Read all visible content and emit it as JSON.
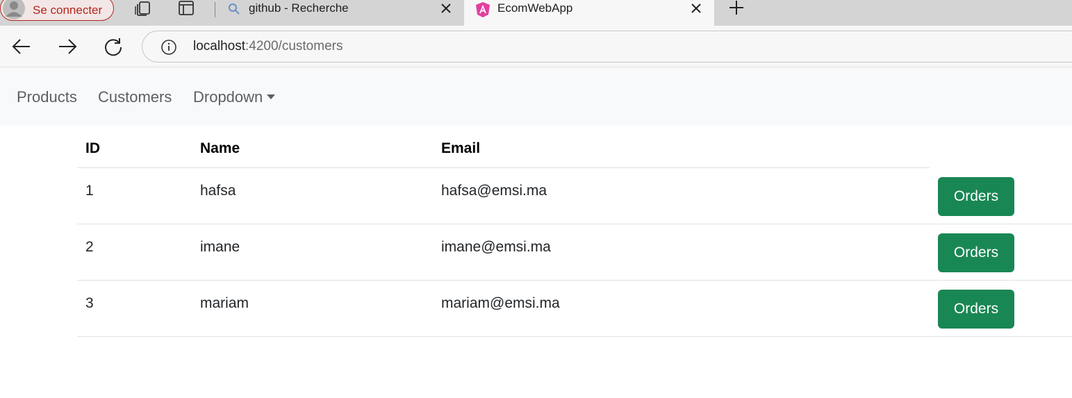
{
  "browser": {
    "profile_label": "Se connecter",
    "tabs": [
      {
        "title": "github - Recherche",
        "favicon": "search-icon",
        "active": false
      },
      {
        "title": "EcomWebApp",
        "favicon": "angular-icon",
        "active": true
      }
    ],
    "url_host": "localhost",
    "url_path": ":4200/customers"
  },
  "navbar": {
    "links": [
      "Products",
      "Customers",
      "Dropdown"
    ]
  },
  "table": {
    "headers": [
      "ID",
      "Name",
      "Email"
    ],
    "rows": [
      {
        "id": "1",
        "name": "hafsa",
        "email": "hafsa@emsi.ma",
        "action": "Orders"
      },
      {
        "id": "2",
        "name": "imane",
        "email": "imane@emsi.ma",
        "action": "Orders"
      },
      {
        "id": "3",
        "name": "mariam",
        "email": "mariam@emsi.ma",
        "action": "Orders"
      }
    ]
  },
  "colors": {
    "button_bg": "#198754",
    "navbar_bg": "#f8f9fa",
    "profile_accent": "#b3261e"
  }
}
